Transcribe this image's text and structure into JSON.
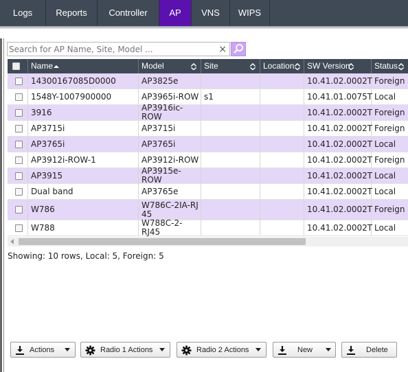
{
  "nav": {
    "tabs": [
      {
        "label": "Logs",
        "active": false
      },
      {
        "label": "Reports",
        "active": false
      },
      {
        "label": "Controller",
        "active": false
      },
      {
        "label": "AP",
        "active": true
      },
      {
        "label": "VNS",
        "active": false
      },
      {
        "label": "WIPS",
        "active": false
      }
    ]
  },
  "search": {
    "placeholder": "Search for AP Name, Site, Model ...",
    "value": "",
    "clear_glyph": "×"
  },
  "table": {
    "columns": [
      {
        "label": "",
        "sort": "none"
      },
      {
        "label": "Name",
        "sort": "asc"
      },
      {
        "label": "Model",
        "sort": "both"
      },
      {
        "label": "Site",
        "sort": "both"
      },
      {
        "label": "Location",
        "sort": "both"
      },
      {
        "label": "SW Version",
        "sort": "both"
      },
      {
        "label": "Status",
        "sort": "both"
      }
    ],
    "rows": [
      {
        "name": "14300167085D0000",
        "model": "AP3825e",
        "site": "",
        "location": "",
        "sw": "10.41.02.0002T",
        "status": "Foreign"
      },
      {
        "name": "1548Y-1007900000",
        "model": "AP3965i-ROW",
        "site": "s1",
        "location": "",
        "sw": "10.41.01.0075T",
        "status": "Local"
      },
      {
        "name": "3916",
        "model": "AP3916ic-ROW",
        "site": "",
        "location": "",
        "sw": "10.41.02.0002T",
        "status": "Foreign"
      },
      {
        "name": "AP3715i",
        "model": "AP3715i",
        "site": "",
        "location": "",
        "sw": "10.41.02.0002T",
        "status": "Foreign"
      },
      {
        "name": "AP3765i",
        "model": "AP3765i",
        "site": "",
        "location": "",
        "sw": "10.41.02.0002T",
        "status": "Local"
      },
      {
        "name": "AP3912i-ROW-1",
        "model": "AP3912i-ROW",
        "site": "",
        "location": "",
        "sw": "10.41.02.0002T",
        "status": "Foreign"
      },
      {
        "name": "AP3915",
        "model": "AP3915e-ROW",
        "site": "",
        "location": "",
        "sw": "10.41.02.0002T",
        "status": "Local"
      },
      {
        "name": "Dual band",
        "model": "AP3765e",
        "site": "",
        "location": "",
        "sw": "10.41.02.0002T",
        "status": "Local"
      },
      {
        "name": "W786",
        "model": "W786C-2IA-RJ45",
        "site": "",
        "location": "",
        "sw": "10.41.02.0002T",
        "status": "Foreign"
      },
      {
        "name": "W788",
        "model": "W788C-2-RJ45",
        "site": "",
        "location": "",
        "sw": "10.41.02.0002T",
        "status": "Local"
      }
    ]
  },
  "status_text": "Showing: 10 rows, Local: 5, Foreign: 5",
  "buttons": [
    {
      "label": "Actions",
      "icon": "download-icon",
      "dropdown": true
    },
    {
      "label": "Radio 1 Actions",
      "icon": "gear-icon",
      "dropdown": true
    },
    {
      "label": "Radio 2 Actions",
      "icon": "gear-icon",
      "dropdown": true
    },
    {
      "label": "New",
      "icon": "download-icon",
      "dropdown": true
    },
    {
      "label": "Delete",
      "icon": "download-icon",
      "dropdown": false
    }
  ],
  "colors": {
    "nav_bg": "#3f4a56",
    "nav_active": "#5a11ad",
    "row_alt": "#e5d7f7",
    "search_button": "#c9a6f2"
  }
}
